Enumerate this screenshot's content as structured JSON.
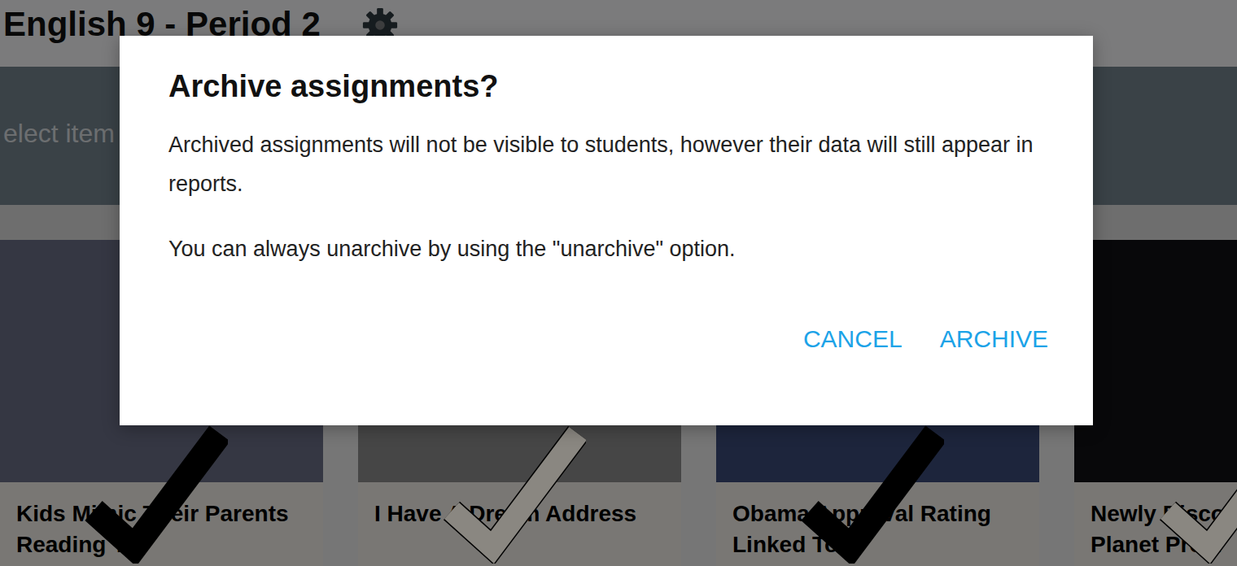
{
  "page": {
    "title": "English 9 - Period 2",
    "toolbar_hint": "elect item"
  },
  "cards": [
    {
      "title": "Kids Mimic Their Parents Reading To",
      "selected": true
    },
    {
      "title": "I Have A Dream Address",
      "selected": false
    },
    {
      "title": "Obama Approval Rating Linked To",
      "selected": true
    },
    {
      "title": "Newly Disco Planet Proxi",
      "selected": false
    }
  ],
  "dialog": {
    "title": "Archive assignments?",
    "paragraphs": [
      "Archived assignments will not be visible to students, however their data will still appear in reports.",
      "You can always unarchive by using the \"unarchive\" option."
    ],
    "buttons": [
      "CANCEL",
      "ARCHIVE"
    ]
  }
}
